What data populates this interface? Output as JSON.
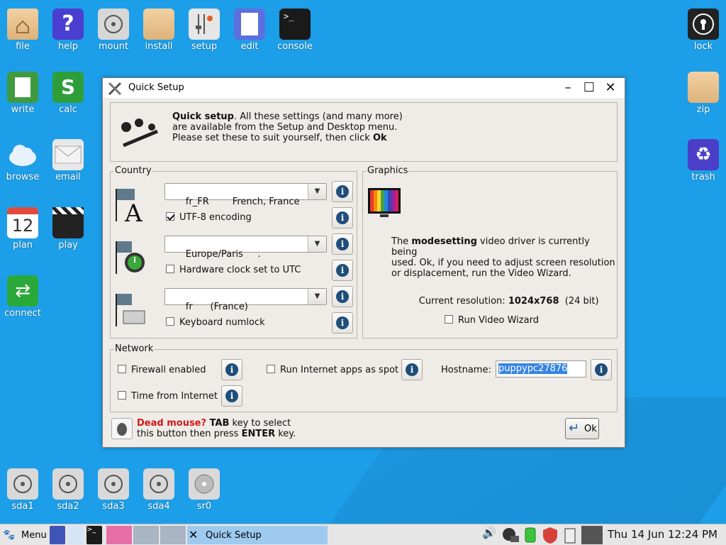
{
  "desktop": {
    "icons_top": [
      {
        "label": "file",
        "icon": "folder-home-icon"
      },
      {
        "label": "help",
        "icon": "help-icon"
      },
      {
        "label": "mount",
        "icon": "drive-icon"
      },
      {
        "label": "install",
        "icon": "box-icon"
      },
      {
        "label": "setup",
        "icon": "settings-icon"
      },
      {
        "label": "edit",
        "icon": "text-editor-icon"
      },
      {
        "label": "console",
        "icon": "terminal-icon"
      }
    ],
    "icons_left": [
      {
        "label": "write",
        "icon": "document-icon"
      },
      {
        "label": "calc",
        "icon": "spreadsheet-icon"
      },
      {
        "label": "browse",
        "icon": "cloud-icon"
      },
      {
        "label": "email",
        "icon": "envelope-icon"
      },
      {
        "label": "plan",
        "icon": "calendar-icon",
        "number": "12"
      },
      {
        "label": "play",
        "icon": "clapperboard-icon"
      },
      {
        "label": "connect",
        "icon": "connect-icon"
      }
    ],
    "icons_right": [
      {
        "label": "lock",
        "icon": "lock-icon"
      },
      {
        "label": "zip",
        "icon": "archive-icon"
      },
      {
        "label": "trash",
        "icon": "recycle-icon"
      }
    ],
    "drives": [
      {
        "label": "sda1"
      },
      {
        "label": "sda2"
      },
      {
        "label": "sda3"
      },
      {
        "label": "sda4"
      },
      {
        "label": "sr0"
      }
    ]
  },
  "window": {
    "title": "Quick Setup",
    "intro_bold": "Quick setup",
    "intro_rest": ". All these settings (and many more)",
    "intro_line2": "are available from the Setup and Desktop menu.",
    "intro_line3a": "Please set these to suit yourself, then click ",
    "intro_line3b": "Ok",
    "country": {
      "legend": "Country",
      "locale": "fr_FR        French, France",
      "utf8_label": "UTF-8 encoding",
      "utf8_checked": true,
      "timezone": "Europe/Paris     .",
      "hwclock_label": "Hardware clock set to UTC",
      "hwclock_checked": false,
      "keyboard": "fr      (France)",
      "numlock_label": "Keyboard numlock",
      "numlock_checked": false
    },
    "graphics": {
      "legend": "Graphics",
      "desc_a": "The ",
      "desc_bold": "modesetting",
      "desc_b": " video driver is currently being",
      "desc_line2": "used. Ok, if you need to adjust screen resolution",
      "desc_line3": "or displacement, run the Video Wizard.",
      "res_label": "Current resolution: ",
      "res_value": "1024x768",
      "res_bits": "  (24 bit)",
      "wizard_label": "Run Video Wizard"
    },
    "network": {
      "legend": "Network",
      "firewall_label": "Firewall enabled",
      "spot_label": "Run Internet apps as spot",
      "hostname_label": "Hostname:",
      "hostname_value": "puppypc27876",
      "time_label": "Time from Internet"
    },
    "footer": {
      "dead_mouse": "Dead mouse?",
      "tab": " TAB",
      "rest1": " key to select",
      "line2a": "this button then press ",
      "enter": "ENTER",
      "line2b": " key.",
      "ok_label": "Ok"
    },
    "info_glyph": "i"
  },
  "taskbar": {
    "menu_label": "Menu",
    "task_label": "Quick Setup",
    "clock": "Thu 14 Jun 12:24 PM"
  }
}
